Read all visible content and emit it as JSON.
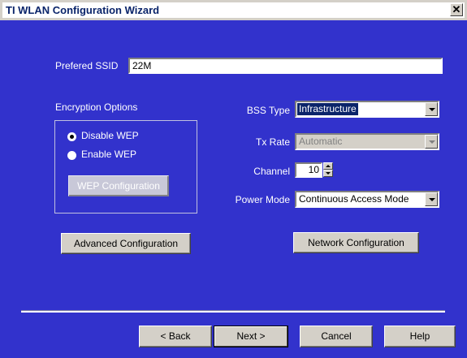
{
  "window": {
    "title": "TI WLAN Configuration Wizard",
    "close_label": "✕"
  },
  "ssid": {
    "label": "Prefered SSID",
    "value": "22M"
  },
  "encryption": {
    "label": "Encryption Options",
    "options": [
      {
        "label": "Disable WEP",
        "checked": true
      },
      {
        "label": "Enable WEP",
        "checked": false
      }
    ],
    "wep_button": "WEP Configuration"
  },
  "bss_type": {
    "label": "BSS Type",
    "value": "Infrastructure"
  },
  "tx_rate": {
    "label": "Tx Rate",
    "value": "Automatic"
  },
  "channel": {
    "label": "Channel",
    "value": "10"
  },
  "power_mode": {
    "label": "Power Mode",
    "value": "Continuous Access Mode"
  },
  "buttons": {
    "advanced": "Advanced Configuration",
    "network": "Network Configuration",
    "back": "< Back",
    "next": "Next >",
    "cancel": "Cancel",
    "help": "Help"
  },
  "colors": {
    "client_bg": "#3232cc",
    "title_text": "#0a246a",
    "selection": "#0a246a"
  }
}
